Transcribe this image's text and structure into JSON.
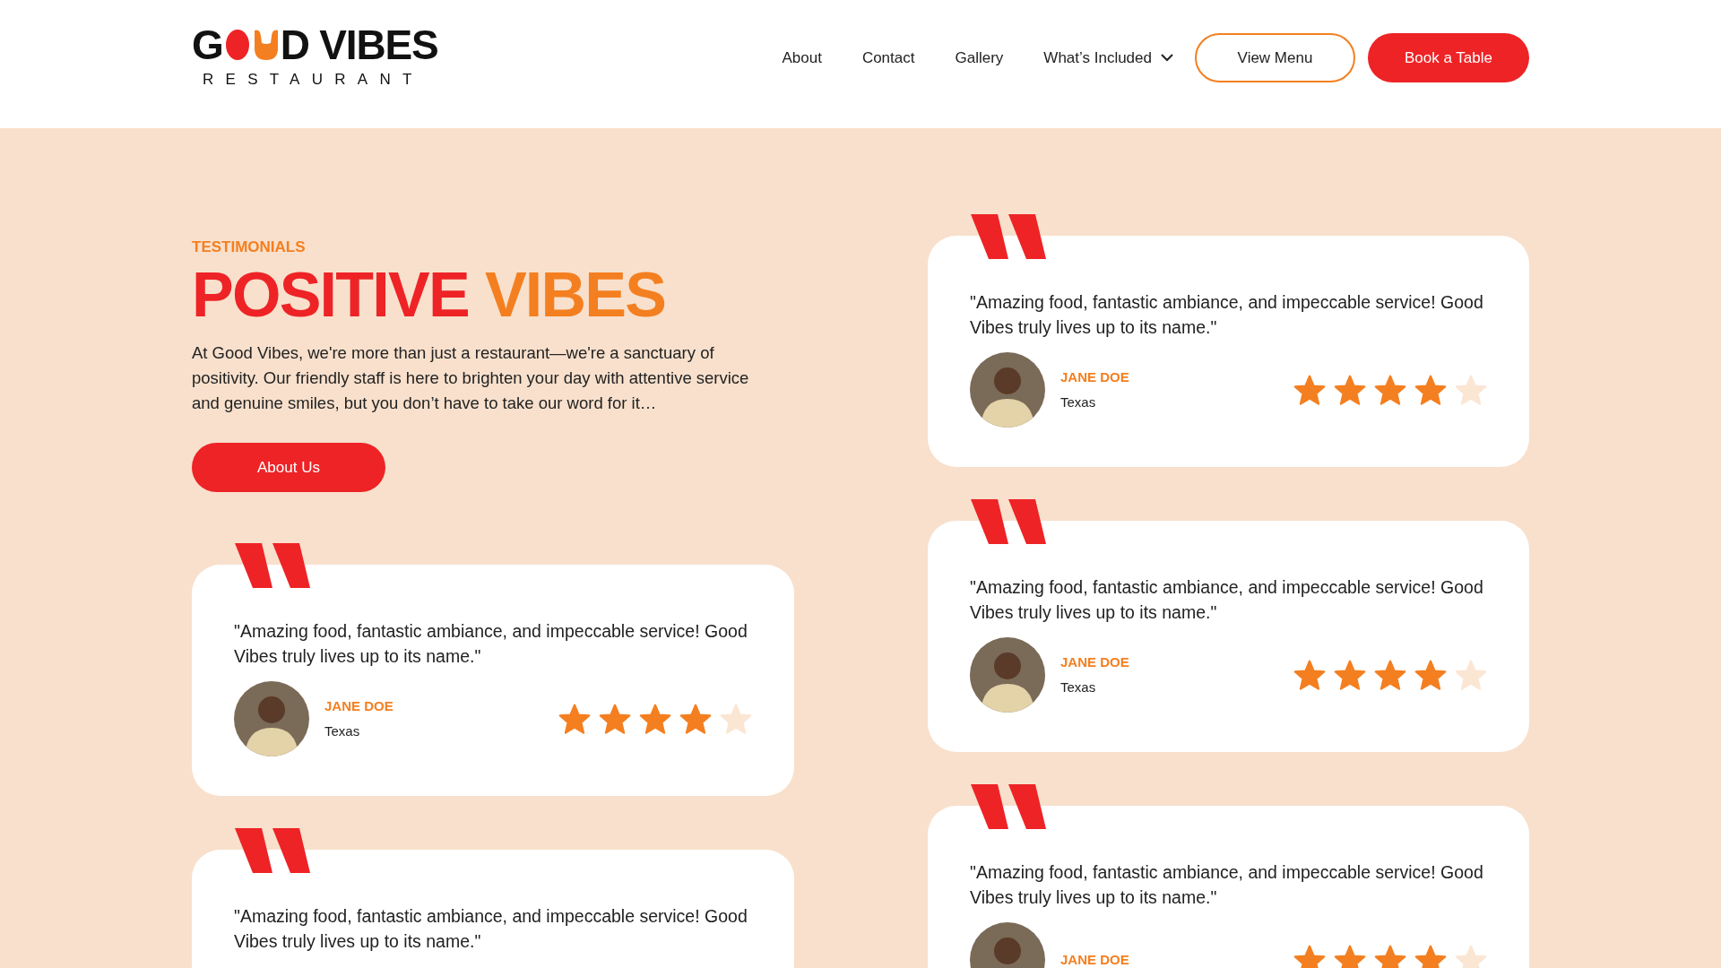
{
  "logo": {
    "word_start": "G",
    "word_end": "D VIBES",
    "subtitle": "RESTAURANT"
  },
  "nav": {
    "links": [
      {
        "label": "About",
        "dropdown": false
      },
      {
        "label": "Contact",
        "dropdown": false
      },
      {
        "label": "Gallery",
        "dropdown": false
      },
      {
        "label": "What’s Included",
        "dropdown": true
      }
    ],
    "buttons": [
      {
        "label": "View Menu",
        "kind": "outline"
      },
      {
        "label": "Book a Table",
        "kind": "filled"
      }
    ]
  },
  "intro": {
    "eyebrow": "TESTIMONIALS",
    "heading": [
      {
        "text": "POSITIVE",
        "color": "#ee2326"
      },
      {
        "text": "VIBES",
        "color": "#f47f20"
      }
    ],
    "body": "At Good Vibes, we're more than just a restaurant—we're a sanctuary of positivity. Our friendly staff is here to brighten your day with attentive service and genuine smiles, but you don’t have to take our word for it…",
    "button": "About Us"
  },
  "left_testimonials": [
    {
      "quote": "\"Amazing food, fantastic ambiance, and impeccable service! Good Vibes truly lives up to its name.\"",
      "name": "JANE DOE",
      "location": "Texas",
      "stars": 4
    },
    {
      "quote": "\"Amazing food, fantastic ambiance, and impeccable service! Good Vibes truly lives up to its name.\""
    }
  ],
  "right_testimonials": [
    {
      "quote": "\"Amazing food, fantastic ambiance, and impeccable service! Good Vibes truly lives up to its name.\"",
      "name": "JANE DOE",
      "location": "Texas",
      "stars": 4
    },
    {
      "quote": "\"Amazing food, fantastic ambiance, and impeccable service! Good Vibes truly lives up to its name.\"",
      "name": "JANE DOE",
      "location": "Texas",
      "stars": 4
    },
    {
      "quote": "\"Amazing food, fantastic ambiance, and impeccable service! Good Vibes truly lives up to its name.\"",
      "name": "JANE DOE",
      "stars": 4
    }
  ]
}
